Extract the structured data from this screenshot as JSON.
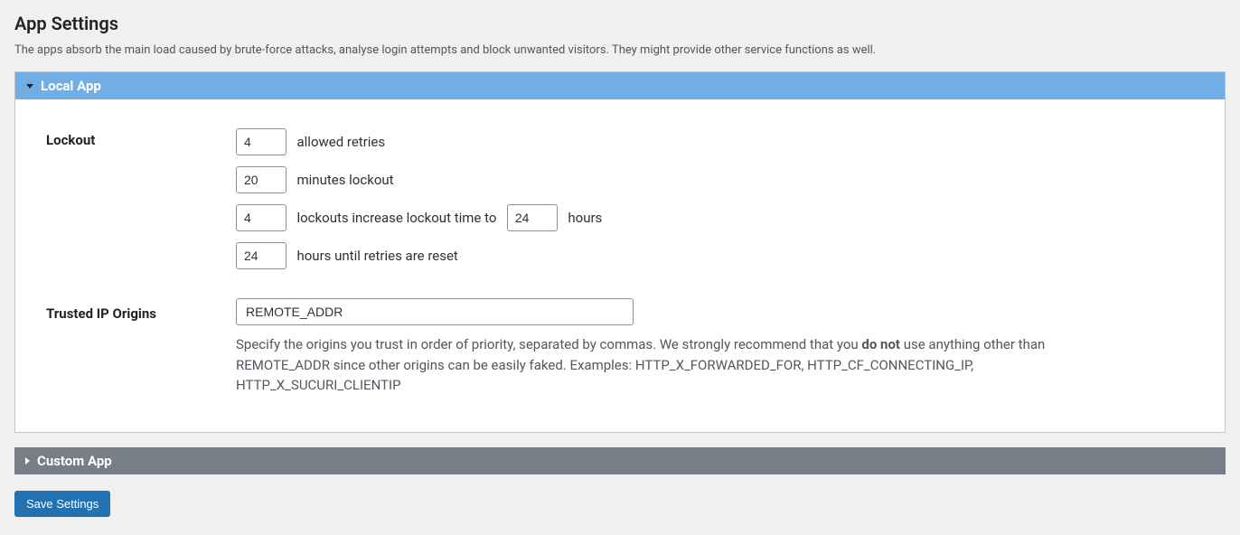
{
  "page": {
    "title": "App Settings",
    "description": "The apps absorb the main load caused by brute-force attacks, analyse login attempts and block unwanted visitors. They might provide other service functions as well."
  },
  "localApp": {
    "header": "Local App",
    "lockout": {
      "label": "Lockout",
      "allowedRetriesValue": "4",
      "allowedRetriesText": "allowed retries",
      "minutesLockoutValue": "20",
      "minutesLockoutText": "minutes lockout",
      "lockoutsValue": "4",
      "lockoutsText1": "lockouts increase lockout time to",
      "hoursValue": "24",
      "lockoutsText2": "hours",
      "resetValue": "24",
      "resetText": "hours until retries are reset"
    },
    "trusted": {
      "label": "Trusted IP Origins",
      "value": "REMOTE_ADDR",
      "hint_pre": "Specify the origins you trust in order of priority, separated by commas. We strongly recommend that you ",
      "hint_bold": "do not",
      "hint_post": " use anything other than REMOTE_ADDR since other origins can be easily faked. Examples: HTTP_X_FORWARDED_FOR, HTTP_CF_CONNECTING_IP, HTTP_X_SUCURI_CLIENTIP"
    }
  },
  "customApp": {
    "header": "Custom App"
  },
  "saveButton": "Save Settings"
}
